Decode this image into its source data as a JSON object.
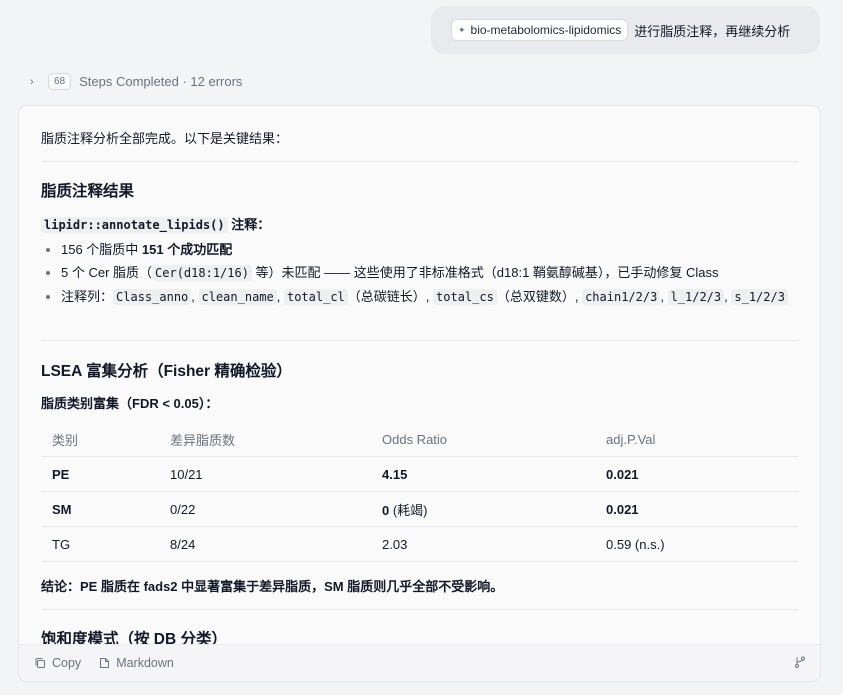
{
  "user_message": {
    "chip_label": "bio-metabolomics-lipidomics",
    "text": "进行脂质注释，再继续分析"
  },
  "steps": {
    "count": "68",
    "label": "Steps Completed · 12 errors"
  },
  "response": {
    "intro": "脂质注释分析全部完成。以下是关键结果：",
    "section1": {
      "title": "脂质注释结果",
      "subtitle_code": "lipidr::annotate_lipids()",
      "subtitle_text": " 注释：",
      "bullet1_pre": "156 个脂质中 ",
      "bullet1_bold": "151 个成功匹配",
      "bullet2_pre": "5 个 Cer 脂质（",
      "bullet2_code": "Cer(d18:1/16)",
      "bullet2_post": " 等）未匹配 —— 这些使用了非标准格式（d18:1 鞘氨醇碱基），已手动修复 Class",
      "bullet3_pre": "注释列：",
      "bullet3_codes": [
        "Class_anno",
        "clean_name",
        "total_cl",
        "total_cs",
        "chain1/2/3",
        "l_1/2/3",
        "s_1/2/3"
      ],
      "bullet3_note1": "（总碳链长）",
      "bullet3_note2": "（总双键数）"
    },
    "section2": {
      "title": "LSEA 富集分析（Fisher 精确检验）",
      "subtitle": "脂质类别富集（FDR < 0.05）：",
      "table": {
        "headers": [
          "类别",
          "差异脂质数",
          "Odds Ratio",
          "adj.P.Val"
        ],
        "rows": [
          {
            "cls": "PE",
            "count": "10/21",
            "or": "4.15",
            "or_note": "",
            "p": "0.021"
          },
          {
            "cls": "SM",
            "count": "0/22",
            "or": "0",
            "or_note": " (耗竭)",
            "p": "0.021"
          },
          {
            "cls": "TG",
            "count": "8/24",
            "or": "2.03",
            "or_note": "",
            "p": "0.59 (n.s.)"
          }
        ]
      },
      "conclusion": "结论：PE 脂质在 fads2 中显著富集于差异脂质，SM 脂质则几乎全部不受影响。"
    },
    "section3": {
      "title": "饱和度模式（按 DB 分类）"
    }
  },
  "footer": {
    "copy_label": "Copy",
    "markdown_label": "Markdown"
  }
}
